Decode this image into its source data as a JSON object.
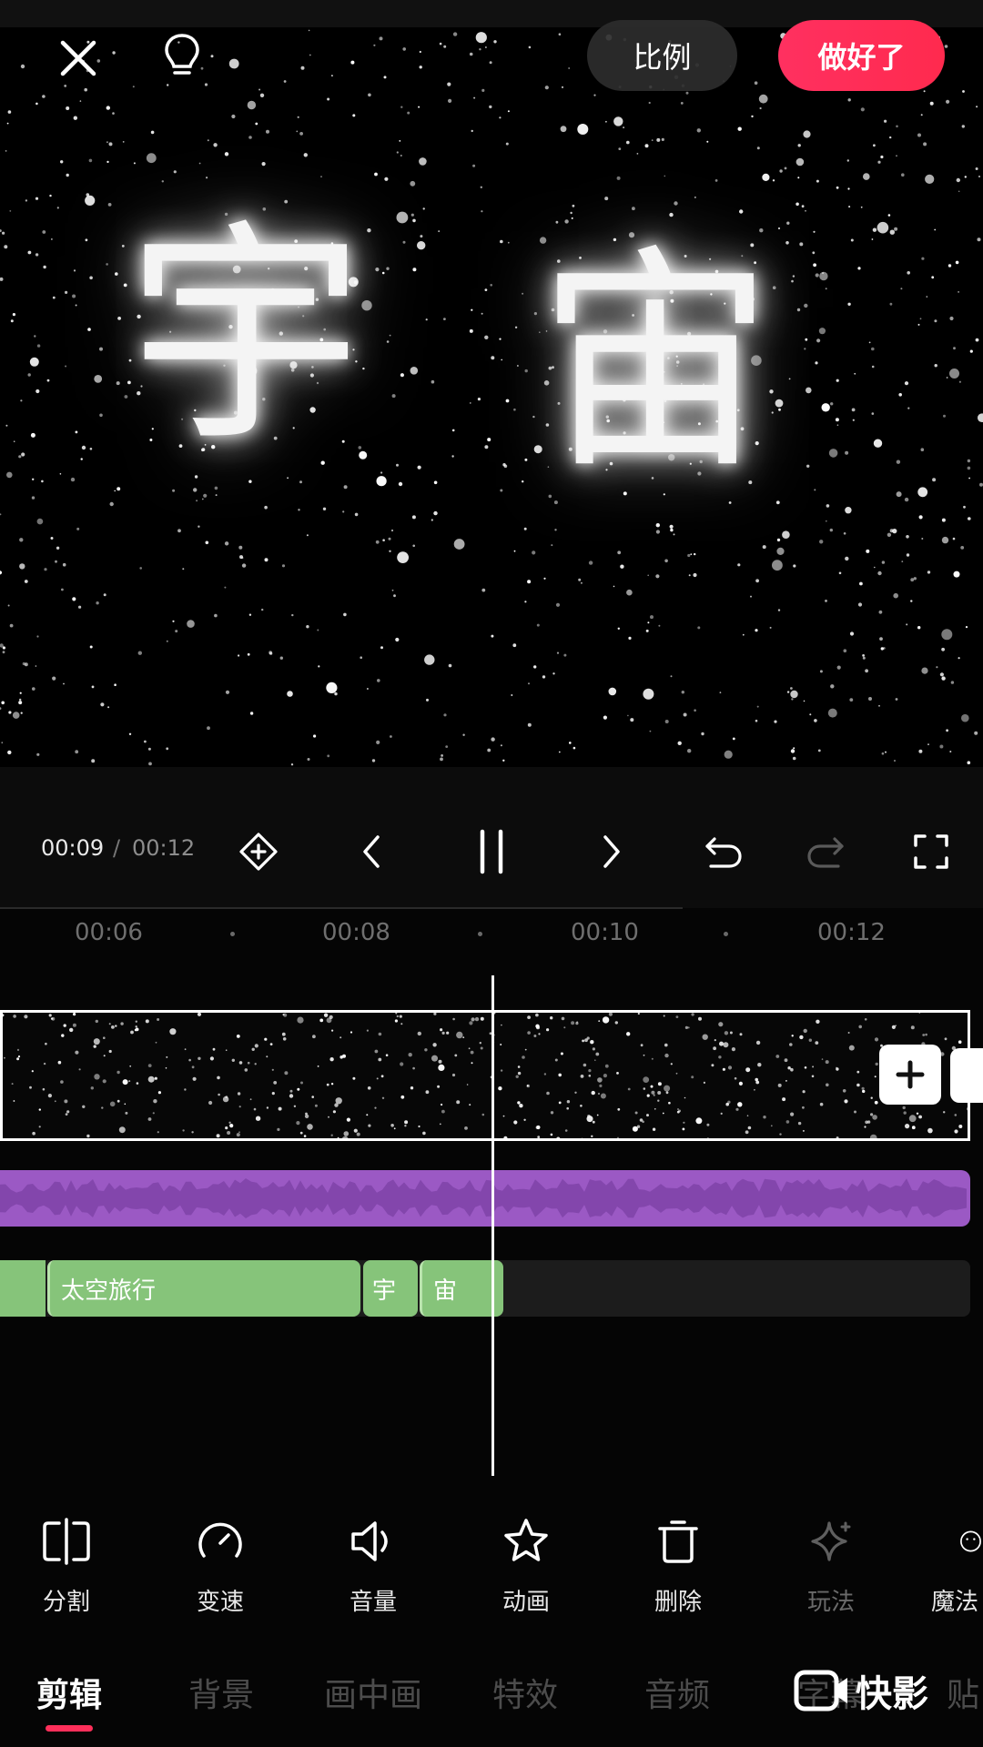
{
  "header": {
    "close_icon": "close-icon",
    "hint_icon": "lightbulb-icon",
    "ratio_label": "比例",
    "done_label": "做好了",
    "done_color": "#ff2a50"
  },
  "preview": {
    "chars": [
      "宇",
      "宙"
    ]
  },
  "controls": {
    "current_time": "00:09",
    "separator": "/",
    "total_time": "00:12",
    "icons": [
      "keyframe-icon",
      "prev-icon",
      "pause-icon",
      "next-icon",
      "undo-icon",
      "redo-icon",
      "fullscreen-icon"
    ]
  },
  "timeline": {
    "ticks": [
      "00:06",
      "00:08",
      "00:10",
      "00:12"
    ],
    "text_clips": [
      "太空旅行",
      "宇",
      "宙"
    ],
    "video_track_color": "#ffffff",
    "audio_track_color": "#9b59c4",
    "text_track_color": "#86c47a"
  },
  "tools": [
    {
      "label": "分割",
      "icon": "split-icon"
    },
    {
      "label": "变速",
      "icon": "speed-icon"
    },
    {
      "label": "音量",
      "icon": "volume-icon"
    },
    {
      "label": "动画",
      "icon": "star-icon"
    },
    {
      "label": "删除",
      "icon": "trash-icon"
    },
    {
      "label": "玩法",
      "icon": "sparkle-icon"
    },
    {
      "label": "魔法",
      "icon": "smile-icon"
    }
  ],
  "tabs": [
    "剪辑",
    "背景",
    "画中画",
    "特效",
    "音频",
    "字幕",
    "贴"
  ],
  "active_tab": "剪辑",
  "watermark": "快影"
}
